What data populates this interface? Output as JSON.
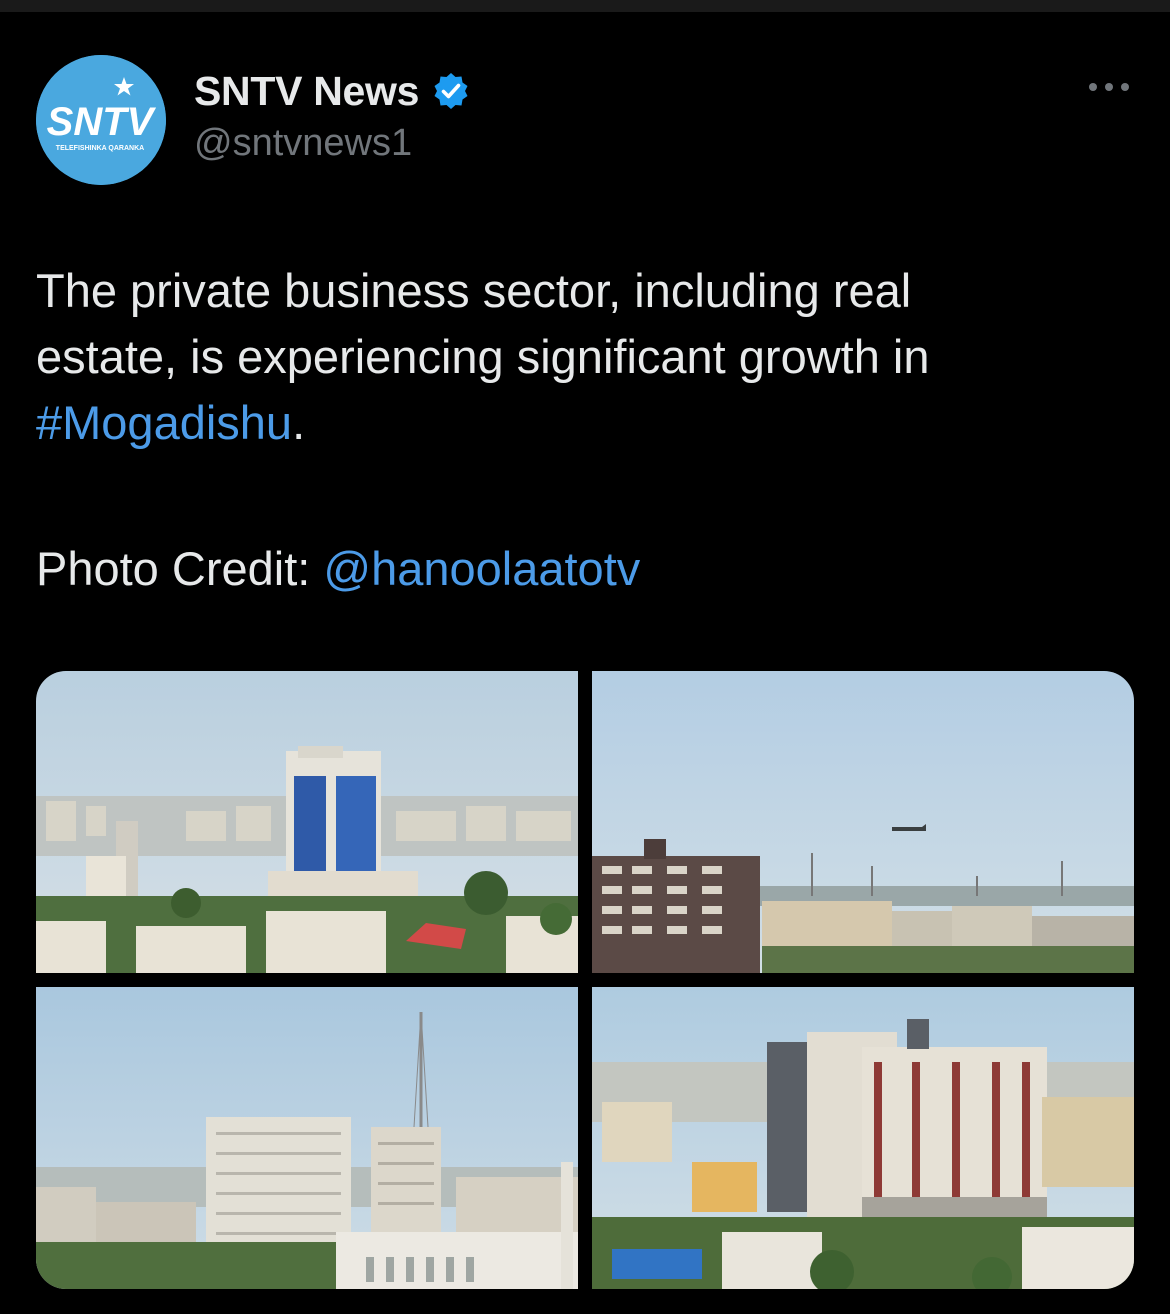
{
  "author": {
    "display_name": "SNTV News",
    "handle": "@sntvnews1",
    "avatar": {
      "logo_text": "SNTV",
      "tagline": "TELEFISHINKA QARANKA",
      "bg_color": "#4aa8df"
    },
    "verified_icon": "verified-badge-icon",
    "verified_color": "#1d9bf0"
  },
  "menu": {
    "icon": "more-horizontal-icon"
  },
  "tweet": {
    "text_line1": "The private business sector, including real",
    "text_line2": "estate, is experiencing significant growth in",
    "hashtag": "#Mogadishu",
    "hashtag_suffix": ".",
    "credit_label": "Photo Credit: ",
    "credit_mention": "@hanoolaatotv",
    "link_color": "#4c9be8"
  },
  "media": {
    "count": 4,
    "photos": [
      {
        "subject": "city skyline with blue glass tower"
      },
      {
        "subject": "apartment block with airplane in sky"
      },
      {
        "subject": "white towers with radio mast"
      },
      {
        "subject": "new high-rise apartment buildings"
      }
    ]
  }
}
